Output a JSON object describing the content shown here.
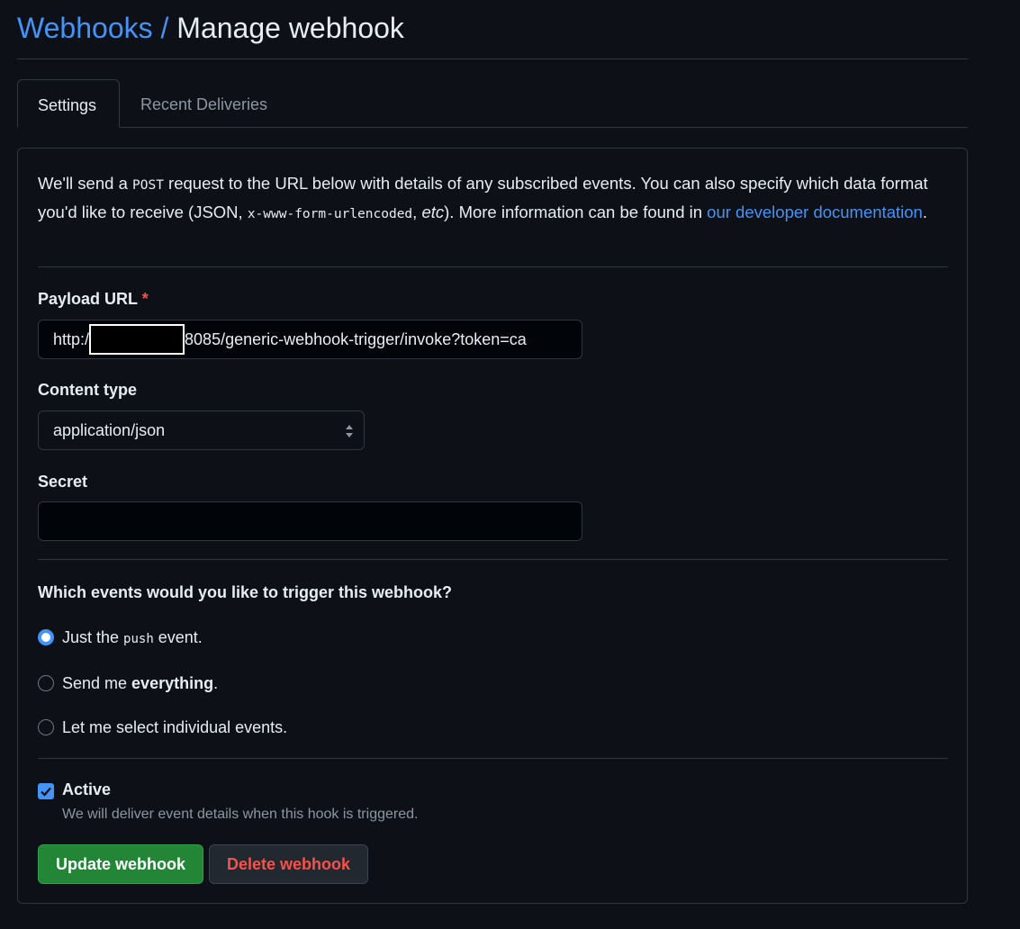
{
  "header": {
    "breadcrumb_parent": "Webhooks",
    "separator": " / ",
    "title": "Manage webhook"
  },
  "tabs": [
    {
      "label": "Settings",
      "active": true
    },
    {
      "label": "Recent Deliveries",
      "active": false
    }
  ],
  "intro": {
    "part1": "We'll send a ",
    "method": "POST",
    "part2": " request to the URL below with details of any subscribed events. You can also specify which data format you'd like to receive (JSON, ",
    "format": "x-www-form-urlencoded",
    "part3": ", ",
    "etc": "etc",
    "part4": "). More information can be found in ",
    "link": "our developer documentation",
    "part5": "."
  },
  "payload_url": {
    "label": "Payload URL",
    "required_mark": "*",
    "value_prefix": "http:/",
    "value_suffix": "8085/generic-webhook-trigger/invoke?token=ca"
  },
  "content_type": {
    "label": "Content type",
    "selected": "application/json"
  },
  "secret": {
    "label": "Secret",
    "value": ""
  },
  "events": {
    "question": "Which events would you like to trigger this webhook?",
    "options": [
      {
        "pre": "Just the ",
        "code": "push",
        "post": " event.",
        "checked": true
      },
      {
        "pre": "Send me ",
        "bold": "everything",
        "post": ".",
        "checked": false
      },
      {
        "label": "Let me select individual events.",
        "checked": false
      }
    ]
  },
  "active": {
    "label": "Active",
    "checked": true,
    "hint": "We will deliver event details when this hook is triggered."
  },
  "buttons": {
    "update": "Update webhook",
    "delete": "Delete webhook"
  },
  "colors": {
    "background": "#0d1117",
    "link": "#4493f8",
    "primary": "#238636",
    "danger": "#f85149",
    "border": "#30363d"
  }
}
